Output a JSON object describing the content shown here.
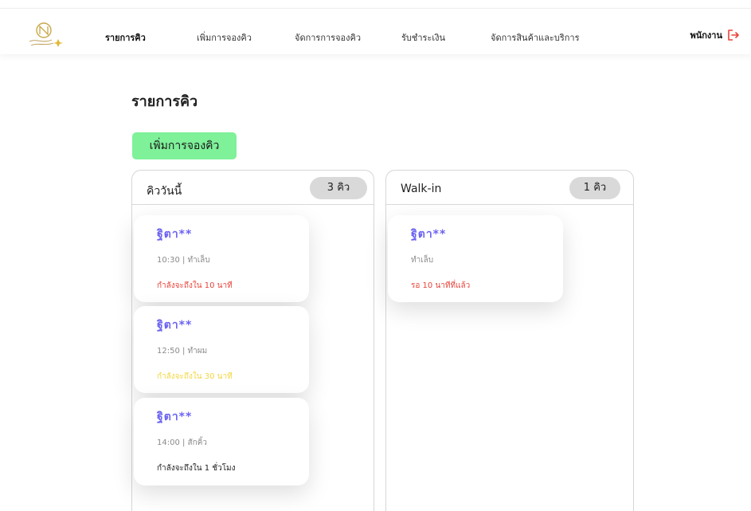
{
  "header": {
    "logo_icon": "salon-logo-icon",
    "nav": [
      {
        "label": "รายการคิว",
        "active": true
      },
      {
        "label": "เพิ่มการจองคิว",
        "active": false
      },
      {
        "label": "จัดการการจองคิว",
        "active": false
      },
      {
        "label": "รับชำระเงิน",
        "active": false
      },
      {
        "label": "จัดการสินค้าและบริการ",
        "active": false
      }
    ],
    "user_label": "พนักงาน",
    "logout_icon": "logout-icon",
    "logout_color": "#e8433a"
  },
  "main": {
    "title": "รายการคิว",
    "add_button": "เพิ่มการจองคิว",
    "add_button_color": "#7ef199"
  },
  "today": {
    "title": "คิววันนี้",
    "count": "3 คิว",
    "items": [
      {
        "name": "ฐิตา**",
        "detail": "10:30 | ทำเล็บ",
        "status": "กำลังจะถึงใน 10 นาที",
        "status_color": "#e8433a"
      },
      {
        "name": "ฐิตา**",
        "detail": "12:50 | ทำผม",
        "status": "กำลังจะถึงใน 30 นาที",
        "status_color": "#f3d640"
      },
      {
        "name": "ฐิตา**",
        "detail": "14:00 | สักคิ้ว",
        "status": "กำลังจะถึงใน 1 ชั่วโมง",
        "status_color": "#222222"
      }
    ]
  },
  "walkin": {
    "title": "Walk-in",
    "count": "1 คิว",
    "items": [
      {
        "name": "ฐิตา**",
        "detail": "ทำเล็บ",
        "status": "รอ 10 นาทีที่แล้ว",
        "status_color": "#e8433a"
      }
    ]
  },
  "colors": {
    "accent_name": "#6b63f2",
    "badge_bg": "#d9d9d9"
  }
}
